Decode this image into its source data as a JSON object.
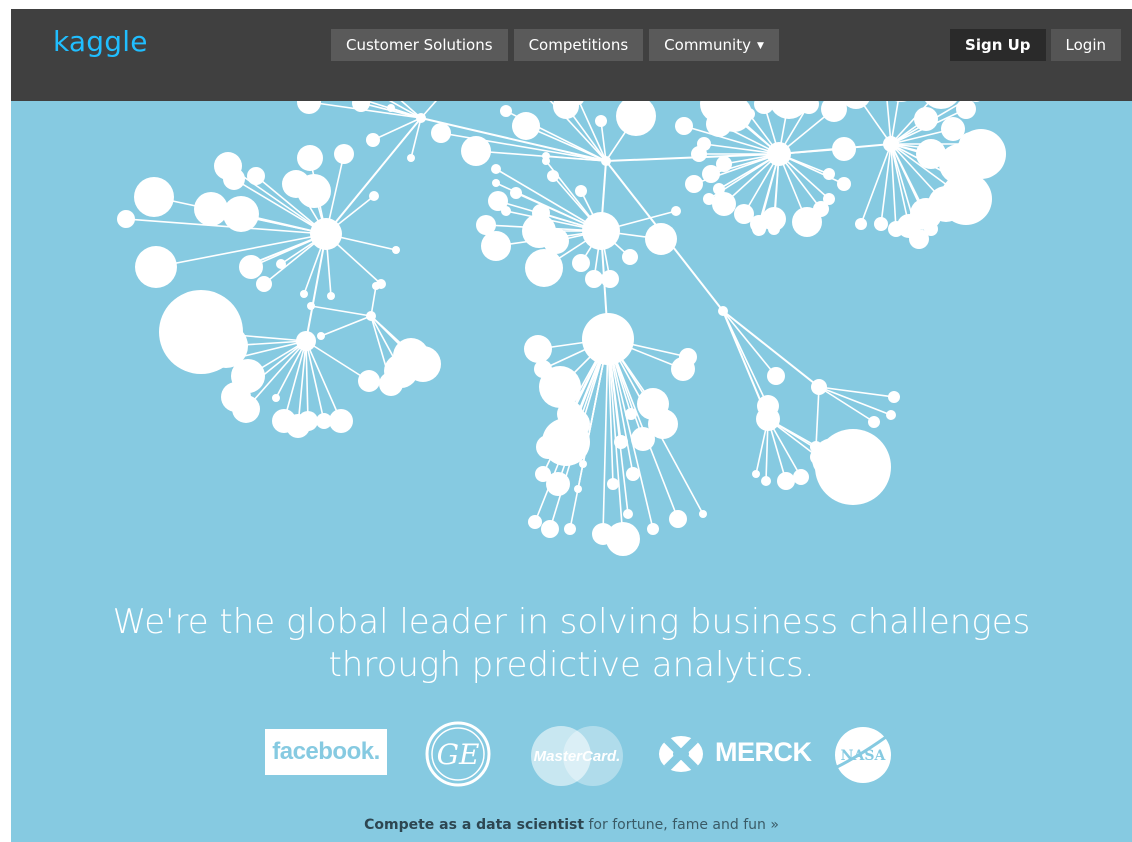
{
  "header": {
    "logo_text": "kaggle",
    "nav": [
      {
        "label": "Customer Solutions"
      },
      {
        "label": "Competitions"
      },
      {
        "label": "Community"
      }
    ],
    "signup_label": "Sign Up",
    "login_label": "Login",
    "caret_icon": "chevron-down-icon"
  },
  "hero": {
    "tagline_line1": "We're the global leader in solving business challenges",
    "tagline_line2": "through predictive analytics.",
    "logos": [
      {
        "name": "facebook",
        "text": "facebook."
      },
      {
        "name": "ge",
        "text": "GE"
      },
      {
        "name": "mastercard",
        "text": "MasterCard."
      },
      {
        "name": "merck",
        "text": "MERCK"
      },
      {
        "name": "nasa",
        "text": "NASA"
      }
    ],
    "cta_bold": "Compete as a data scientist",
    "cta_rest": " for fortune, fame and fun »"
  },
  "colors": {
    "header_bg": "#404040",
    "hero_bg": "#86cae1",
    "logo": "#20beff",
    "network": "#ffffff"
  }
}
